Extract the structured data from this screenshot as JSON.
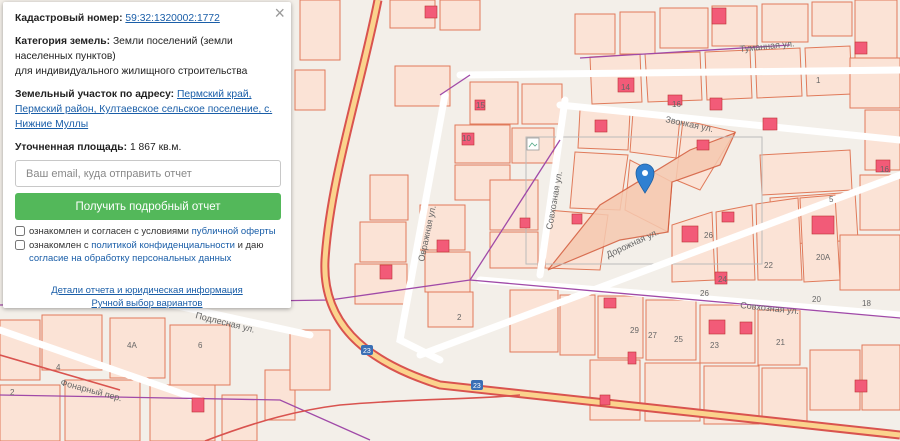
{
  "info_panel": {
    "cadastral_label": "Кадастровый номер:",
    "cadastral_value": "59:32:1320002:1772",
    "category_label": "Категория земель:",
    "category_value_line1": "Земли поселений (земли",
    "category_value_line2": "населенных пунктов)",
    "category_value_line3": "для индивидуального жилищного строительства",
    "address_label": "Земельный участок по адресу:",
    "address_part1": "Пермский край,",
    "address_part2": "Пермский район, Култаевское сельское поселение, с.",
    "address_part3": "Нижние Муллы",
    "area_label": "Уточненная площадь:",
    "area_value": "1 867 кв.м.",
    "email_placeholder": "Ваш email, куда отправить отчет",
    "email_value": "",
    "submit_label": "Получить подробный отчет",
    "consent1_text": "ознакомлен и согласен с условиями",
    "consent1_link": "публичной оферты",
    "consent2_text": "ознакомлен с",
    "consent2_link": "политикой конфиденциальности",
    "consent2_mid": "и даю",
    "consent2_link2": "согласие на обработку персональных данных",
    "details_link": "Детали отчета и юридическая информация",
    "manual_link": "Ручной выбор вариантов",
    "close_symbol": "×"
  },
  "map": {
    "colors": {
      "background": "#f3efe9",
      "parcel_fill": "#fbe3d6",
      "parcel_stroke": "#e07a5a",
      "building_fill": "#f25b78",
      "road_red": "#d9534f",
      "road_yellow": "#fbd38d",
      "boundary_purple": "#a04aa8",
      "street_white": "#ffffff",
      "marker_blue": "#2f80d1",
      "selected_fill": "#f6c9b0"
    },
    "street_labels": {
      "tumannaya": "Туманная ул.",
      "zvonkaya": "Звонкая ул.",
      "sovkhoznaya_v": "Совхозная ул.",
      "ovrazhnaya": "Овражная ул.",
      "dorozhnaya": "Дорожная ул.",
      "sovkhoznaya_h": "Совхозная ул.",
      "podlesnaya": "Подлесная ул.",
      "fonarny": "Фонарный пер."
    },
    "road_badges": [
      "23",
      "23"
    ],
    "house_numbers": [
      "1",
      "3",
      "5",
      "3",
      "14",
      "16",
      "12",
      "15",
      "10",
      "10",
      "9",
      "2",
      "2",
      "4",
      "6",
      "8",
      "26",
      "24",
      "22",
      "20",
      "20А",
      "16",
      "17",
      "13",
      "29",
      "27",
      "25",
      "23",
      "21",
      "4",
      "6",
      "4А",
      "2",
      "2",
      "18"
    ]
  }
}
